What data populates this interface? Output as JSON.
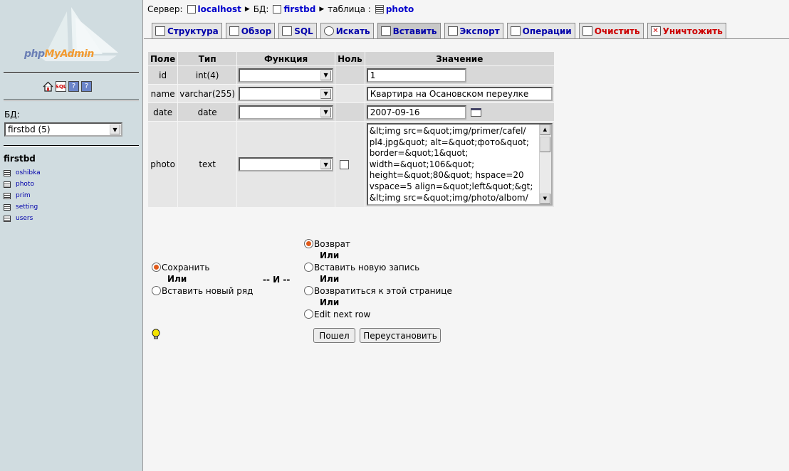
{
  "sidebar": {
    "logo_php": "php",
    "logo_my": "My",
    "logo_admin": "Admin",
    "db_label": "БД:",
    "db_selected": "firstbd (5)",
    "db_name": "firstbd",
    "tables": [
      "oshibka",
      "photo",
      "prim",
      "setting",
      "users"
    ]
  },
  "breadcrumb": {
    "server_label": "Сервер:",
    "server": "localhost",
    "db_label": "БД:",
    "db": "firstbd",
    "table_label": "таблица :",
    "table": "photo"
  },
  "tabs": [
    "Структура",
    "Обзор",
    "SQL",
    "Искать",
    "Вставить",
    "Экспорт",
    "Операции",
    "Очистить",
    "Уничтожить"
  ],
  "table_headers": {
    "field": "Поле",
    "type": "Тип",
    "function": "Функция",
    "null": "Ноль",
    "value": "Значение"
  },
  "rows": [
    {
      "field": "id",
      "type": "int(4)",
      "value": "1"
    },
    {
      "field": "name",
      "type": "varchar(255)",
      "value": "Квартира на Осановском переулке"
    },
    {
      "field": "date",
      "type": "date",
      "value": "2007-09-16"
    },
    {
      "field": "photo",
      "type": "text",
      "value_lines": [
        "&lt;img src=&quot;img/primer/cafel/",
        "pl4.jpg&quot; alt=&quot;фото&quot;",
        "border=&quot;1&quot;",
        "width=&quot;106&quot;",
        "height=&quot;80&quot; hspace=20",
        "vspace=5 align=&quot;left&quot;&gt;",
        "&lt;img src=&quot;img/photo/albom/"
      ]
    }
  ],
  "options": {
    "save": "Сохранить",
    "or": "Или",
    "insert_new_row": "Вставить новый ряд",
    "and": "-- И --",
    "return": "Возврат",
    "insert_new_record": "Вставить новую запись",
    "return_to_page": "Возвратиться к этой странице",
    "edit_next_row": "Edit next row"
  },
  "buttons": {
    "go": "Пошел",
    "reset": "Переустановить"
  },
  "colors": {
    "sidebar_bg": "#d0dce0",
    "link": "#0000cc",
    "danger": "#cc0000",
    "radio_on": "#e05a1a"
  }
}
